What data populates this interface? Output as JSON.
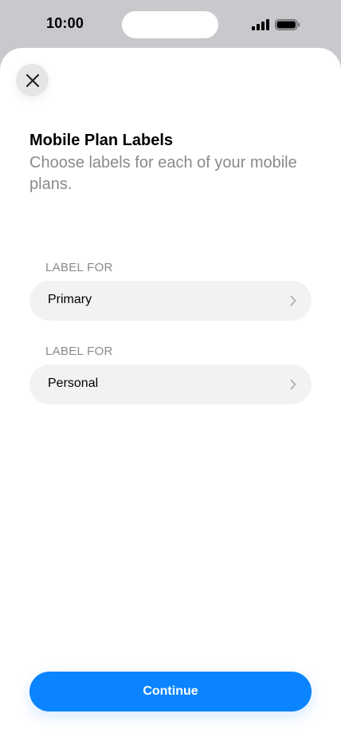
{
  "status_bar": {
    "time": "10:00",
    "signal_icon": "cellular-signal-icon",
    "battery_icon": "battery-icon"
  },
  "sheet": {
    "close_icon": "close-icon",
    "title": "Mobile Plan Labels",
    "subtitle": "Choose labels for each of your mobile plans.",
    "sections": [
      {
        "header": "LABEL FOR",
        "value": "Primary"
      },
      {
        "header": "LABEL FOR",
        "value": "Personal"
      }
    ],
    "chevron_icon": "chevron-right-icon",
    "continue_label": "Continue"
  },
  "colors": {
    "accent": "#0a84ff",
    "row_background": "#f2f2f3",
    "secondary_text": "#8a8a8e",
    "backdrop": "#c8c8cd"
  }
}
